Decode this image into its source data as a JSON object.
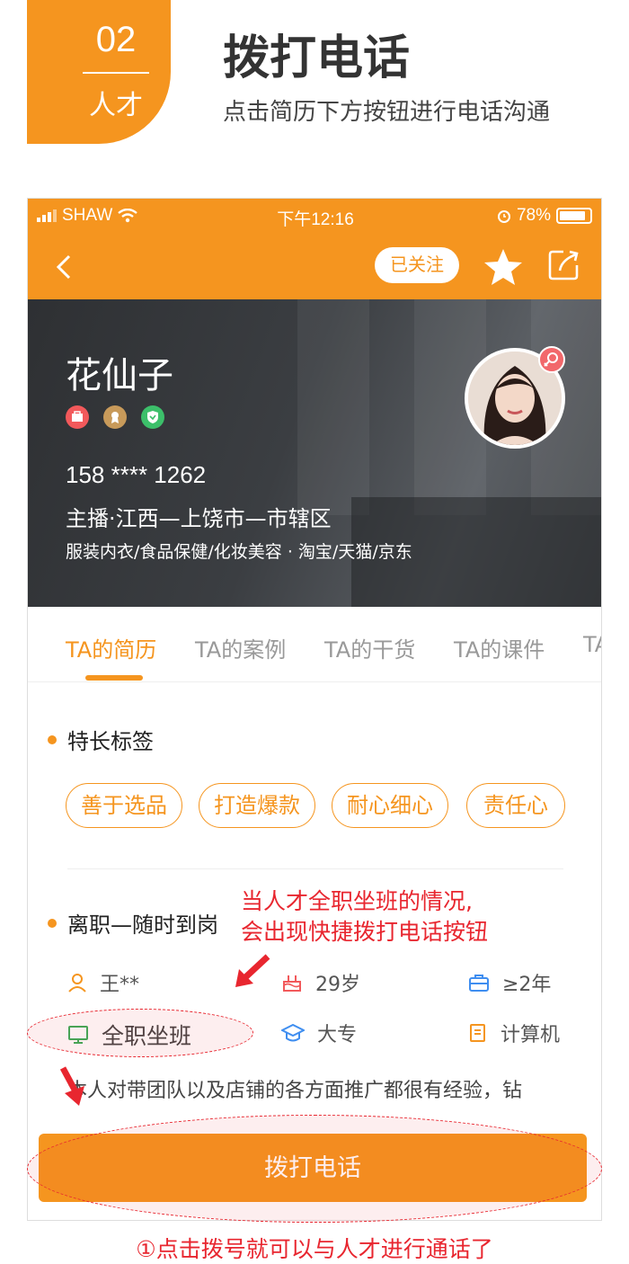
{
  "header": {
    "badge_number": "02",
    "badge_label": "人才",
    "title": "拨打电话",
    "subtitle": "点击简历下方按钮进行电话沟通"
  },
  "statusbar": {
    "carrier": "SHAW",
    "time": "下午12:16",
    "battery": "78%"
  },
  "navbar": {
    "follow_label": "已关注"
  },
  "profile": {
    "name": "花仙子",
    "phone": "158 **** 1262",
    "location": "主播·江西—上饶市—市辖区",
    "categories": "服装内衣/食品保健/化妆美容 · 淘宝/天猫/京东"
  },
  "tabs": [
    "TA的简历",
    "TA的案例",
    "TA的干货",
    "TA的课件",
    "TA"
  ],
  "skills": {
    "title": "特长标签",
    "tags": [
      "善于选品",
      "打造爆款",
      "耐心细心",
      "责任心"
    ]
  },
  "status_section": {
    "title": "离职—随时到岗"
  },
  "info": {
    "name": "王**",
    "age": "29岁",
    "experience": "≥2年",
    "work_type": "全职坐班",
    "education": "大专",
    "major": "计算机"
  },
  "description": "本人对带团队以及店铺的各方面推广都很有经验，钻",
  "call_button": "拨打电话",
  "annotation": {
    "line1": "当人才全职坐班的情况,",
    "line2": "会出现快捷拨打电话按钮"
  },
  "footer_note": "①点击拨号就可以与人才进行通话了",
  "colors": {
    "accent": "#f5951f",
    "annotation_red": "#e8262f"
  }
}
